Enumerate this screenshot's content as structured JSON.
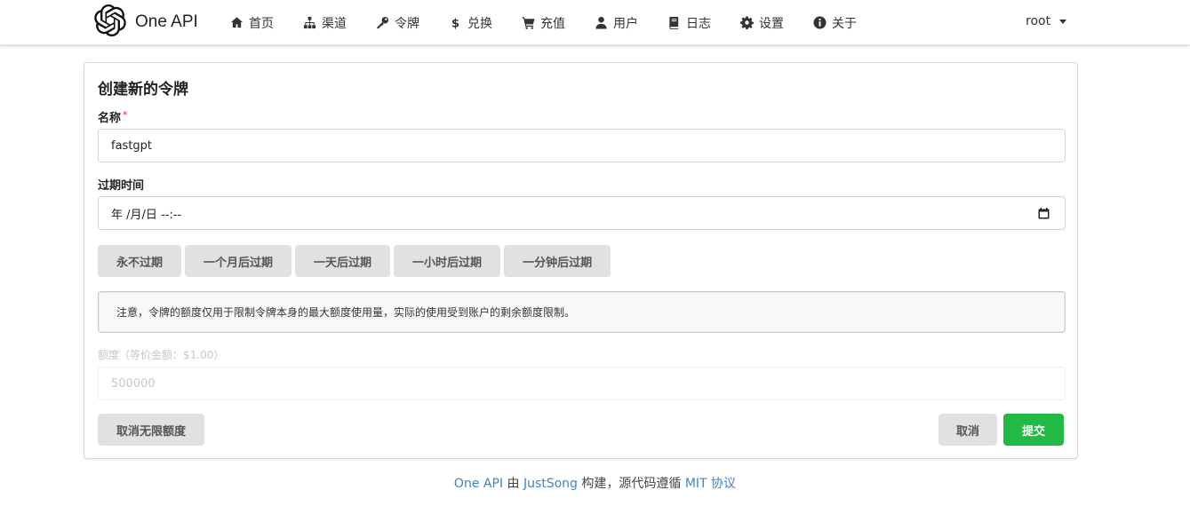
{
  "app": {
    "name": "One API",
    "logo_icon": "openai-logo-icon"
  },
  "nav": {
    "items": [
      {
        "label": "首页",
        "icon": "home-icon"
      },
      {
        "label": "渠道",
        "icon": "sitemap-icon"
      },
      {
        "label": "令牌",
        "icon": "key-icon"
      },
      {
        "label": "兑换",
        "icon": "dollar-icon"
      },
      {
        "label": "充值",
        "icon": "cart-icon"
      },
      {
        "label": "用户",
        "icon": "user-icon"
      },
      {
        "label": "日志",
        "icon": "book-icon"
      },
      {
        "label": "设置",
        "icon": "gear-icon"
      },
      {
        "label": "关于",
        "icon": "info-icon"
      }
    ],
    "user": "root"
  },
  "form": {
    "title": "创建新的令牌",
    "name_label": "名称",
    "name_required_mark": "*",
    "name_value": "fastgpt",
    "expire_label": "过期时间",
    "expire_value": "年 /月/日 --:--",
    "quick_buttons": [
      "永不过期",
      "一个月后过期",
      "一天后过期",
      "一小时后过期",
      "一分钟后过期"
    ],
    "notice": "注意，令牌的额度仅用于限制令牌本身的最大额度使用量，实际的使用受到账户的剩余额度限制。",
    "quota_label": "额度（等价金额：$1.00）",
    "quota_value": "500000",
    "unlimited_button": "取消无限额度",
    "cancel_button": "取消",
    "submit_button": "提交"
  },
  "footer": {
    "app_link": "One API",
    "by": " 由 ",
    "author_link": "JustSong",
    "text": " 构建，源代码遵循 ",
    "license_link": "MIT 协议"
  },
  "colors": {
    "submit": "#21ba45",
    "link": "#4183c4",
    "required": "#db2828"
  }
}
